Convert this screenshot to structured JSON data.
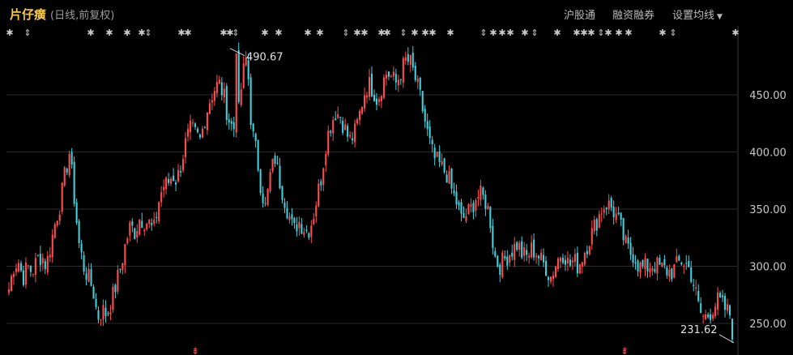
{
  "header": {
    "title": "片仔癀",
    "subtitle": "(日线,前复权)",
    "links": [
      "沪股通",
      "融资融券",
      "设置均线"
    ]
  },
  "colors": {
    "up": "#ff4d4f",
    "down": "#3fd1dc",
    "grid": "#2a2a2a",
    "axis_text": "#c8c8c8",
    "marker": "#c8c8c8",
    "background": "#000000"
  },
  "chart_data": {
    "type": "candlestick",
    "title": "片仔癀",
    "subtitle": "(日线,前复权)",
    "y_ticks": [
      450,
      400,
      350,
      300,
      250
    ],
    "y_tick_labels": [
      "450.00",
      "400.00",
      "350.00",
      "300.00",
      "250.00"
    ],
    "ylim": [
      230,
      495
    ],
    "grid": true,
    "annotations": {
      "max_label": "490.67",
      "max_value": 490.67,
      "min_label": "231.62",
      "min_value": 231.62
    },
    "marker_glyphs": [
      "✱",
      "⇕"
    ],
    "bottom_marker_glyph": "⇟",
    "series": [
      {
        "name": "price",
        "closes": [
          280,
          300,
          305,
          290,
          300,
          295,
          305,
          310,
          300,
          320,
          340,
          355,
          380,
          400,
          360,
          320,
          300,
          290,
          280,
          255,
          262,
          258,
          270,
          285,
          300,
          320,
          335,
          330,
          342,
          340,
          338,
          330,
          355,
          370,
          372,
          380,
          375,
          392,
          410,
          420,
          415,
          410,
          430,
          445,
          455,
          460,
          450,
          430,
          420,
          425,
          465,
          485,
          420,
          400,
          370,
          350,
          380,
          395,
          375,
          360,
          345,
          330,
          340,
          335,
          330,
          340,
          360,
          380,
          410,
          425,
          435,
          432,
          420,
          410,
          415,
          430,
          450,
          460,
          455,
          445,
          460,
          470,
          465,
          460,
          470,
          480,
          478,
          465,
          450,
          430,
          410,
          395,
          390,
          385,
          380,
          365,
          355,
          340,
          345,
          350,
          360,
          362,
          358,
          345,
          310,
          300,
          305,
          310,
          315,
          320,
          310,
          308,
          315,
          312,
          305,
          300,
          290,
          300,
          310,
          312,
          300,
          305,
          300,
          310,
          320,
          330,
          340,
          350,
          355,
          352,
          345,
          335,
          320,
          312,
          310,
          300,
          298,
          300,
          302,
          300,
          298,
          296,
          295,
          300,
          305,
          302,
          296,
          280,
          260,
          255,
          258,
          265,
          270,
          265,
          260,
          256
        ]
      }
    ]
  }
}
